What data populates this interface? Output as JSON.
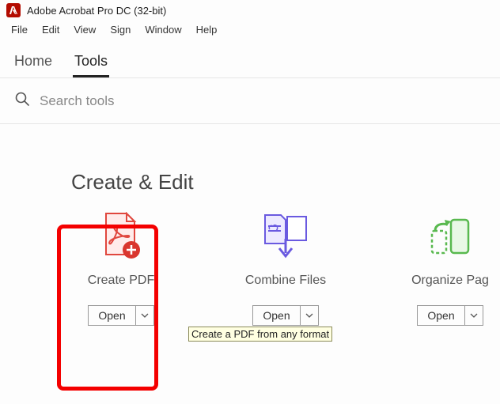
{
  "app": {
    "title": "Adobe Acrobat Pro DC (32-bit)"
  },
  "menu": {
    "file": "File",
    "edit": "Edit",
    "view": "View",
    "sign": "Sign",
    "window": "Window",
    "help": "Help"
  },
  "tabs": {
    "home": "Home",
    "tools": "Tools"
  },
  "search": {
    "placeholder": "Search tools"
  },
  "section": {
    "title": "Create & Edit"
  },
  "cards": {
    "create": {
      "label": "Create PDF",
      "open": "Open"
    },
    "combine": {
      "label": "Combine Files",
      "open": "Open"
    },
    "organize": {
      "label": "Organize Pag",
      "open": "Open"
    }
  },
  "tooltip": "Create a PDF from any format"
}
